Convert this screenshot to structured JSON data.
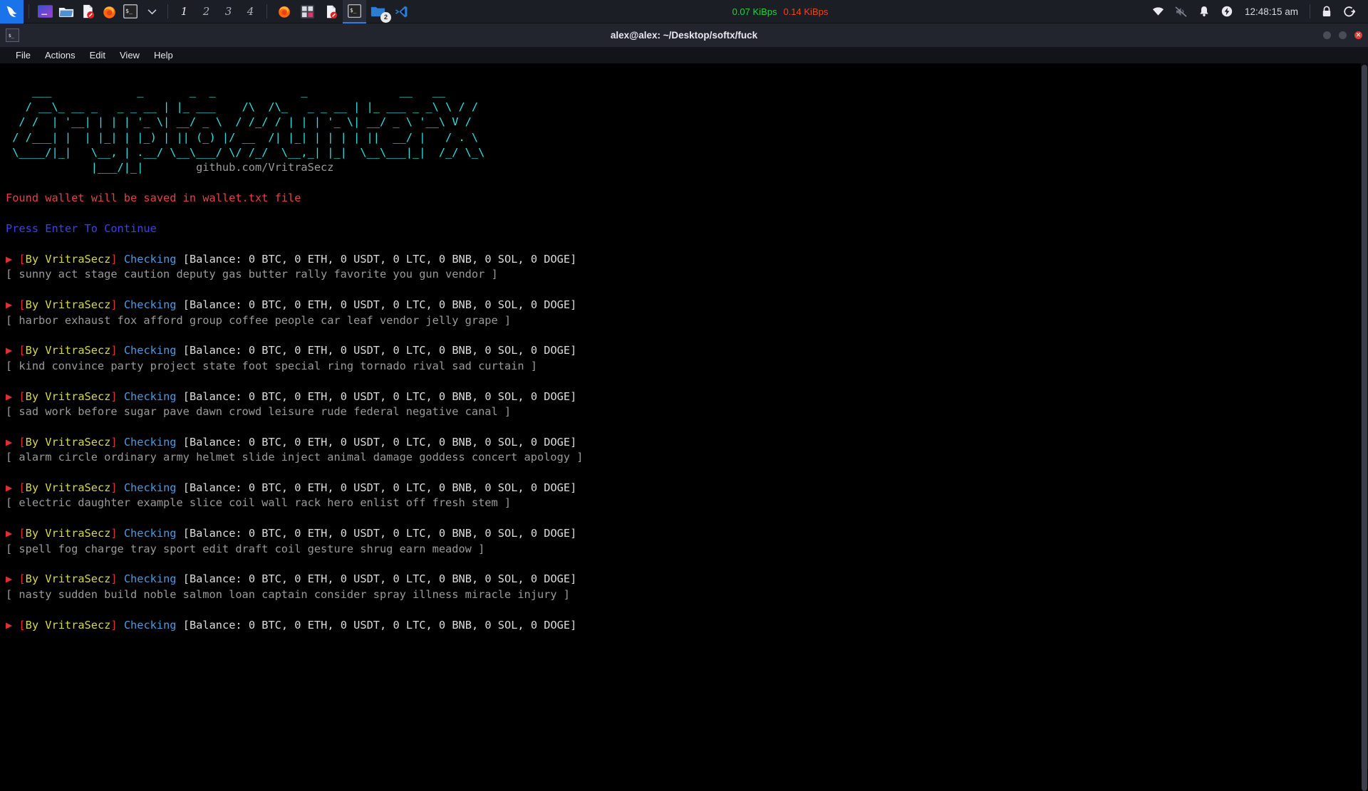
{
  "taskbar": {
    "start_icon": "kali-dragon-icon",
    "launchers": [
      {
        "name": "terminal-emulator-launcher",
        "icon": "terminal-gradient-icon"
      },
      {
        "name": "file-manager-launcher",
        "icon": "folder-icon"
      },
      {
        "name": "text-editor-launcher",
        "icon": "document-icon"
      },
      {
        "name": "firefox-launcher",
        "icon": "firefox-icon"
      },
      {
        "name": "terminal-launcher",
        "icon": "terminal-prompt-icon"
      },
      {
        "name": "launcher-dropdown",
        "icon": "chevron-down-icon"
      }
    ],
    "workspaces": [
      {
        "label": "1",
        "active": true
      },
      {
        "label": "2",
        "active": false
      },
      {
        "label": "3",
        "active": false
      },
      {
        "label": "4",
        "active": false
      }
    ],
    "tasks": [
      {
        "name": "task-firefox",
        "icon": "firefox-icon",
        "selected": false,
        "badge": ""
      },
      {
        "name": "task-calculator",
        "icon": "calculator-icon",
        "selected": false,
        "badge": ""
      },
      {
        "name": "task-text-editor",
        "icon": "document-icon",
        "selected": false,
        "badge": ""
      },
      {
        "name": "task-terminal",
        "icon": "terminal-prompt-icon",
        "selected": true,
        "badge": ""
      },
      {
        "name": "task-file-manager",
        "icon": "folder-icon",
        "selected": false,
        "badge": "2"
      },
      {
        "name": "task-vscode",
        "icon": "vscode-icon",
        "selected": false,
        "badge": ""
      }
    ],
    "network": {
      "download": "0.07 KiBps",
      "download_color": "#2ecc40",
      "upload": "0.14 KiBps",
      "upload_color": "#e8491d"
    },
    "tray": [
      {
        "name": "wifi-icon"
      },
      {
        "name": "volume-muted-icon"
      },
      {
        "name": "notification-bell-icon"
      },
      {
        "name": "power-icon"
      }
    ],
    "clock": "12:48:15 am",
    "tray_right": [
      {
        "name": "lock-icon"
      },
      {
        "name": "logout-icon"
      }
    ]
  },
  "window": {
    "title": "alex@alex: ~/Desktop/softx/fuck",
    "icon": "terminal-prompt-icon",
    "menu": [
      "File",
      "Actions",
      "Edit",
      "View",
      "Help"
    ],
    "controls": {
      "minimize": "minimize-button",
      "maximize": "maximize-button",
      "close": "✕"
    }
  },
  "terminal": {
    "banner_lines": [
      "    ___             _       _  _             _              __   __",
      "   / __\\_ __ _   _ _ __ | |_ ___    /\\  /\\_   _ _ __ | |_ ___ _ _\\ \\ / /",
      "  / /  | '__| | | | '_ \\| __/ _ \\  / /_/ / | | | '_ \\| __/ _ \\ '__\\ V / ",
      " / /___| |  | |_| | |_) | || (_) |/ __  /| |_| | | | | ||  __/ |   / . \\",
      " \\____/|_|   \\__, | .__/ \\__\\___/ \\/ /_/  \\__,_| |_|  \\__\\___|_|  /_/ \\_\\",
      "             |___/|_|        github.com/VritraSecz"
    ],
    "ascii_art": "   ___             _       _  _             _              __   __\n  / __\\_ __ _   _ _ __ | |_ ___    /\\  /\\_   _ _ __ | |_ ___ _ _\\ \\ / /\n / /  | '__| | | | '_ \\| __/ _ \\  / /_/ / | | | '_ \\| __/ _ \\ '__\\ V /\n/ /___| |  | |_| | |_) | || (_) |/ __  /| |_| | | | | ||  __/ |   / . \\\n\\____/|_|   \\__, | .__/ \\__\\___/ \\/ /_/  \\__,_| |_|  \\__\\___|_|  /_/ \\_\\\n            |___/|_|",
    "github_url": "github.com/VritraSecz",
    "warning": "Found wallet will be saved in wallet.txt file",
    "prompt_press": "Press Enter To Continue",
    "arrow_glyph": "▶",
    "author_tag": "By VritraSecz",
    "checking_label": "Checking",
    "balance_text": "Balance: 0 BTC, 0 ETH, 0 USDT, 0 LTC, 0 BNB, 0 SOL, 0 DOGE",
    "entries": [
      {
        "mnemonic": "[ sunny act stage caution deputy gas butter rally favorite you gun vendor ]"
      },
      {
        "mnemonic": "[ harbor exhaust fox afford group coffee people car leaf vendor jelly grape ]"
      },
      {
        "mnemonic": "[ kind convince party project state foot special ring tornado rival sad curtain ]"
      },
      {
        "mnemonic": "[ sad work before sugar pave dawn crowd leisure rude federal negative canal ]"
      },
      {
        "mnemonic": "[ alarm circle ordinary army helmet slide inject animal damage goddess concert apology ]"
      },
      {
        "mnemonic": "[ electric daughter example slice coil wall rack hero enlist off fresh stem ]"
      },
      {
        "mnemonic": "[ spell fog charge tray sport edit draft coil gesture shrug earn meadow ]"
      },
      {
        "mnemonic": "[ nasty sudden build noble salmon loan captain consider spray illness miracle injury ]"
      },
      {
        "mnemonic": ""
      }
    ],
    "colors": {
      "banner": "#2fe2e2",
      "warning": "#e3424a",
      "press_enter": "#4040e8",
      "arrow": "#e03030",
      "author": "#d8d84a",
      "checking": "#4a9ae0",
      "balance": "#dcdcdc",
      "mnemonic": "#9a9a9a"
    }
  }
}
